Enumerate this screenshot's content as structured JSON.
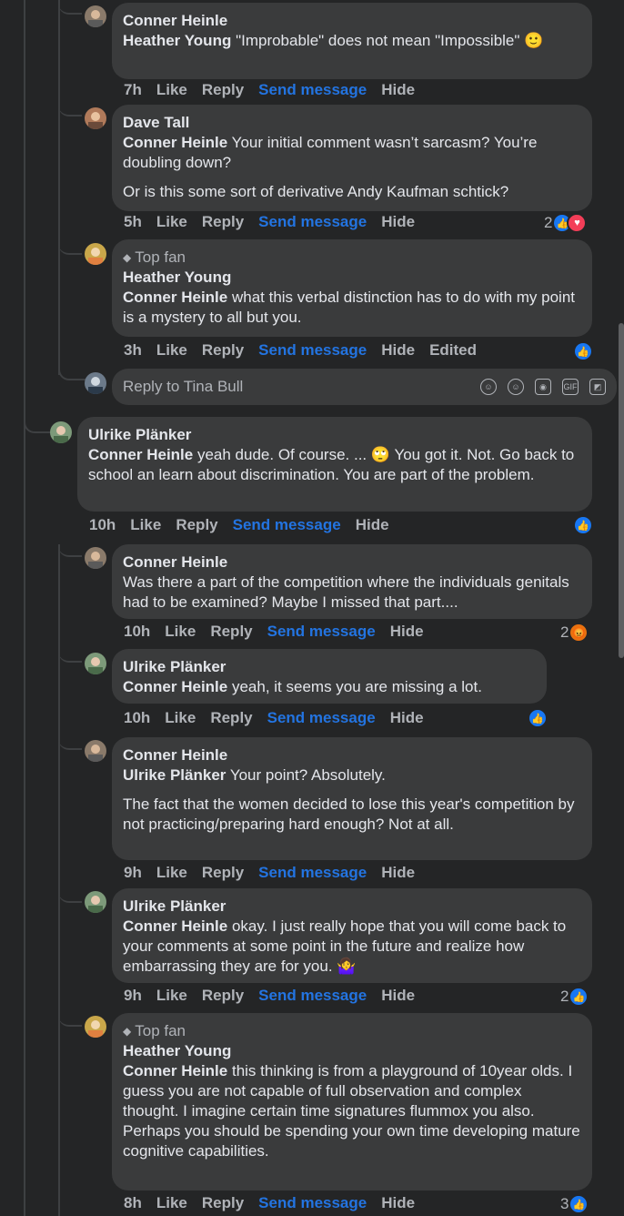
{
  "comments": [
    {
      "name": "Conner Heinle",
      "mention": "Heather Young",
      "text": " \"Improbable\" does not mean \"Impossible\" 🙂",
      "time": "7h"
    },
    {
      "name": "Dave Tall",
      "mention": "Conner Heinle",
      "text": " Your initial comment wasn’t sarcasm? You’re doubling down?",
      "text2": "Or is this some sort of derivative Andy Kaufman schtick?",
      "time": "5h",
      "reaction_count": "2"
    },
    {
      "badge": "Top fan",
      "name": "Heather Young",
      "mention": "Conner Heinle",
      "text": " what this verbal distinction has to do with my point is a mystery to all but you.",
      "time": "3h",
      "edited": "Edited"
    },
    {
      "name": "Ulrike Plänker",
      "mention": "Conner Heinle",
      "text": " yeah dude. Of course. ... 🙄 You got it. Not. Go back to school an learn about discrimination. You are part of the problem.",
      "time": "10h"
    },
    {
      "name": "Conner Heinle",
      "text": "Was there a part of the competition where the individuals genitals had to be examined? Maybe I missed that part....",
      "time": "10h",
      "reaction_count": "2"
    },
    {
      "name": "Ulrike Plänker",
      "mention": "Conner Heinle",
      "text": " yeah, it seems you are missing a lot.",
      "time": "10h"
    },
    {
      "name": "Conner Heinle",
      "mention": "Ulrike Plänker",
      "text": " Your point? Absolutely.",
      "text2": "The fact that the women decided to lose this year's competition by not practicing/preparing hard enough? Not at all.",
      "time": "9h"
    },
    {
      "name": "Ulrike Plänker",
      "mention": "Conner Heinle",
      "text": " okay. I just really hope that you will come back to your comments at some point in the future and realize how embarrassing they are for you. 🤷‍♀️",
      "time": "9h",
      "reaction_count": "2"
    },
    {
      "badge": "Top fan",
      "name": "Heather Young",
      "mention": "Conner Heinle",
      "text": " this thinking is from a playground of 10year olds. I guess you are not capable of full observation and complex thought. I imagine certain time signatures flummox you also. Perhaps you should be spending your own time developing mature cognitive capabilities.",
      "time": "8h",
      "reaction_count": "3"
    }
  ],
  "actions": {
    "like": "Like",
    "reply": "Reply",
    "send_message": "Send message",
    "hide": "Hide"
  },
  "reply_box": {
    "placeholder": "Reply to Tina Bull"
  },
  "reaction_icons": {
    "like": "thumbs-up-icon",
    "love": "heart-icon",
    "angry": "angry-face-icon"
  },
  "colors": {
    "background": "#242526",
    "bubble": "#3a3b3c",
    "link": "#2374e1",
    "like": "#1877f2",
    "love": "#f33e58",
    "angry": "#e9710f"
  }
}
